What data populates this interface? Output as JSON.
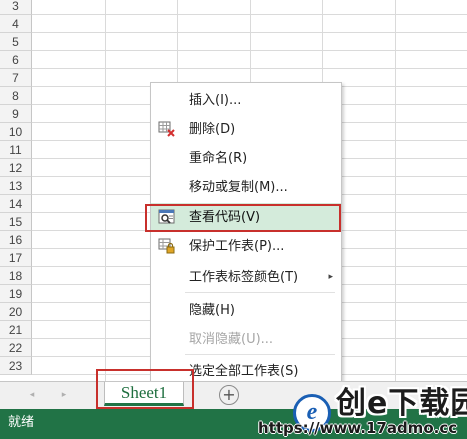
{
  "grid": {
    "rows": [
      "3",
      "4",
      "5",
      "6",
      "7",
      "8",
      "9",
      "10",
      "11",
      "12",
      "13",
      "14",
      "15",
      "16",
      "17",
      "18",
      "19",
      "20",
      "21",
      "22",
      "23"
    ]
  },
  "context_menu": {
    "items": [
      {
        "label": "插入(I)...",
        "icon": "",
        "disabled": false,
        "highlighted": false,
        "submenu": false
      },
      {
        "label": "删除(D)",
        "icon": "delete-sheet-icon",
        "disabled": false,
        "highlighted": false,
        "submenu": false
      },
      {
        "label": "重命名(R)",
        "icon": "",
        "disabled": false,
        "highlighted": false,
        "submenu": false
      },
      {
        "label": "移动或复制(M)...",
        "icon": "",
        "disabled": false,
        "highlighted": false,
        "submenu": false
      },
      {
        "label": "查看代码(V)",
        "icon": "view-code-icon",
        "disabled": false,
        "highlighted": true,
        "submenu": false
      },
      {
        "label": "保护工作表(P)...",
        "icon": "protect-sheet-icon",
        "disabled": false,
        "highlighted": false,
        "submenu": false
      },
      {
        "label": "工作表标签颜色(T)",
        "icon": "",
        "disabled": false,
        "highlighted": false,
        "submenu": true
      },
      {
        "label": "隐藏(H)",
        "icon": "",
        "disabled": false,
        "highlighted": false,
        "submenu": false
      },
      {
        "label": "取消隐藏(U)...",
        "icon": "",
        "disabled": true,
        "highlighted": false,
        "submenu": false
      },
      {
        "label": "选定全部工作表(S)",
        "icon": "",
        "disabled": false,
        "highlighted": false,
        "submenu": false
      }
    ],
    "submenu_arrow": "▸"
  },
  "tabbar": {
    "nav_prev": "◂",
    "nav_next": "▸",
    "sheet_tab": "Sheet1",
    "add_sheet": "+"
  },
  "statusbar": {
    "status": "就绪"
  },
  "watermark": {
    "logo_letter": "e",
    "title": "创e下载园",
    "url": "https://www.17admo.cc"
  },
  "colors": {
    "excel_green": "#217346",
    "menu_highlight": "#d4ebdb",
    "annotation_red": "#c8302c"
  }
}
